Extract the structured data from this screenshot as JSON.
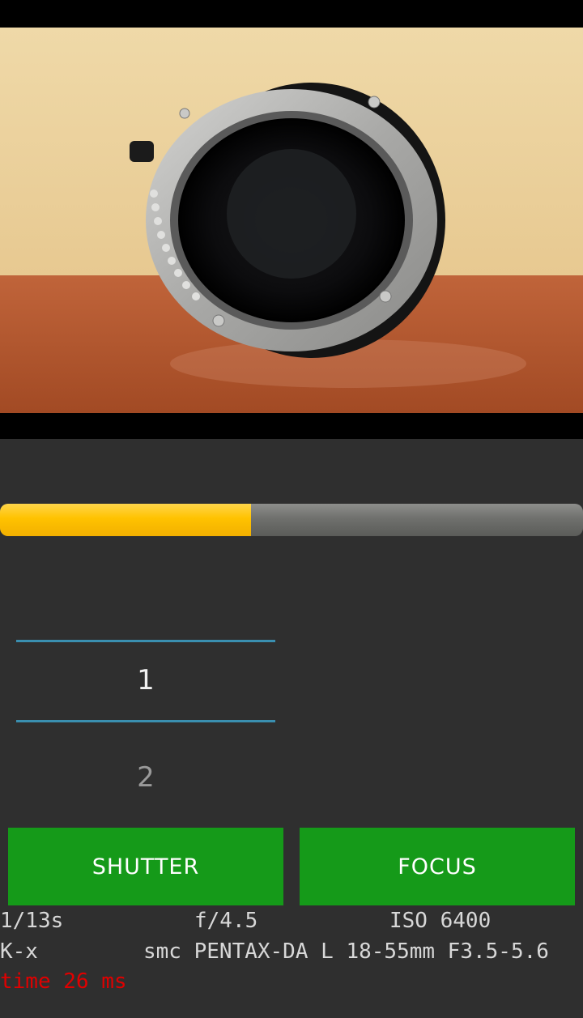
{
  "preview": {
    "alt": "camera live view",
    "colors": {
      "wall": "#e8c88a",
      "table": "#b4572e",
      "lens_ring": "#b8b8b6"
    }
  },
  "progress": {
    "level_percent": 43,
    "fill_color": "#ffc200",
    "track_color": "#6f706d"
  },
  "picker": {
    "current_value": "1",
    "next_value": "2",
    "line_color": "#3a8fb0"
  },
  "buttons": {
    "shutter_label": "SHUTTER",
    "focus_label": "FOCUS",
    "color": "#159a19"
  },
  "exposure": {
    "shutter_speed": "1/13s",
    "aperture": "f/4.5",
    "iso": "ISO 6400"
  },
  "camera": {
    "model": "K-x",
    "lens": "smc PENTAX-DA L 18-55mm F3.5-5.6"
  },
  "status": {
    "timing": "time 26 ms",
    "color": "#e00000"
  }
}
